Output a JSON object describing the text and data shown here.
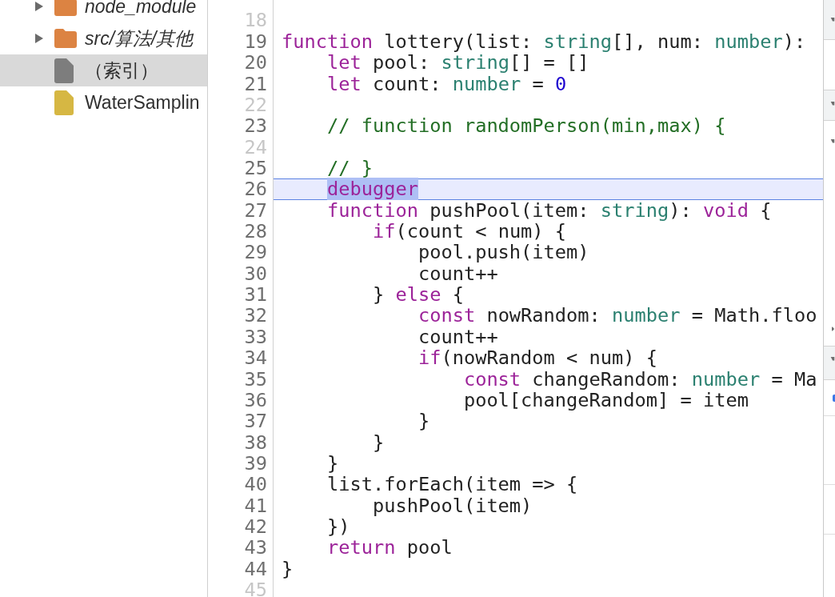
{
  "file_tree": {
    "items": [
      {
        "kind": "folder",
        "name": "node_module",
        "expanded": false,
        "selected": false,
        "color": "#dc8342"
      },
      {
        "kind": "folder",
        "name": "src/算法/其他",
        "expanded": false,
        "selected": false,
        "color": "#dc8342"
      },
      {
        "kind": "file",
        "name": "（索引）",
        "selected": true,
        "color": "#7d7d7d"
      },
      {
        "kind": "file",
        "name": "WaterSamplin",
        "selected": false,
        "color": "#d6b743"
      }
    ]
  },
  "code": {
    "lines": [
      {
        "number": "18",
        "dimmed": true,
        "current": false
      },
      {
        "number": "19",
        "dimmed": false,
        "current": false,
        "tokens": [
          {
            "kind": "keyword",
            "text": "function"
          },
          {
            "kind": "plain",
            "text": " lottery(list: "
          },
          {
            "kind": "type",
            "text": "string"
          },
          {
            "kind": "plain",
            "text": "[], num: "
          },
          {
            "kind": "type",
            "text": "number"
          },
          {
            "kind": "plain",
            "text": "):"
          }
        ]
      },
      {
        "number": "20",
        "dimmed": false,
        "current": false,
        "tokens": [
          {
            "kind": "keyword",
            "text": "    let"
          },
          {
            "kind": "plain",
            "text": " pool: "
          },
          {
            "kind": "type",
            "text": "string"
          },
          {
            "kind": "plain",
            "text": "[] = []"
          }
        ]
      },
      {
        "number": "21",
        "dimmed": false,
        "current": false,
        "tokens": [
          {
            "kind": "keyword",
            "text": "    let"
          },
          {
            "kind": "plain",
            "text": " count: "
          },
          {
            "kind": "type",
            "text": "number"
          },
          {
            "kind": "plain",
            "text": " = "
          },
          {
            "kind": "number",
            "text": "0"
          }
        ]
      },
      {
        "number": "22",
        "dimmed": true,
        "current": false
      },
      {
        "number": "23",
        "dimmed": false,
        "current": false,
        "tokens": [
          {
            "kind": "comment",
            "text": "    // function randomPerson(min,max) {"
          }
        ]
      },
      {
        "number": "24",
        "dimmed": true,
        "current": false
      },
      {
        "number": "25",
        "dimmed": false,
        "current": false,
        "tokens": [
          {
            "kind": "comment",
            "text": "    // }"
          }
        ]
      },
      {
        "number": "26",
        "dimmed": false,
        "current": true,
        "tokens": [
          {
            "kind": "keyword",
            "text": "    debugger",
            "highlighted": true
          }
        ]
      },
      {
        "number": "27",
        "dimmed": false,
        "current": false,
        "tokens": [
          {
            "kind": "keyword",
            "text": "    function"
          },
          {
            "kind": "plain",
            "text": " pushPool(item: "
          },
          {
            "kind": "type",
            "text": "string"
          },
          {
            "kind": "plain",
            "text": "): "
          },
          {
            "kind": "keyword",
            "text": "void"
          },
          {
            "kind": "plain",
            "text": " {"
          }
        ]
      },
      {
        "number": "28",
        "dimmed": false,
        "current": false,
        "tokens": [
          {
            "kind": "keyword",
            "text": "        if"
          },
          {
            "kind": "plain",
            "text": "(count < num) {"
          }
        ]
      },
      {
        "number": "29",
        "dimmed": false,
        "current": false,
        "tokens": [
          {
            "kind": "plain",
            "text": "            pool.push(item)"
          }
        ]
      },
      {
        "number": "30",
        "dimmed": false,
        "current": false,
        "tokens": [
          {
            "kind": "plain",
            "text": "            count++"
          }
        ]
      },
      {
        "number": "31",
        "dimmed": false,
        "current": false,
        "tokens": [
          {
            "kind": "plain",
            "text": "        } "
          },
          {
            "kind": "keyword",
            "text": "else"
          },
          {
            "kind": "plain",
            "text": " {"
          }
        ]
      },
      {
        "number": "32",
        "dimmed": false,
        "current": false,
        "tokens": [
          {
            "kind": "keyword",
            "text": "            const"
          },
          {
            "kind": "plain",
            "text": " nowRandom: "
          },
          {
            "kind": "type",
            "text": "number"
          },
          {
            "kind": "plain",
            "text": " = Math.floo"
          }
        ]
      },
      {
        "number": "33",
        "dimmed": false,
        "current": false,
        "tokens": [
          {
            "kind": "plain",
            "text": "            count++"
          }
        ]
      },
      {
        "number": "34",
        "dimmed": false,
        "current": false,
        "tokens": [
          {
            "kind": "keyword",
            "text": "            if"
          },
          {
            "kind": "plain",
            "text": "(nowRandom < num) {"
          }
        ]
      },
      {
        "number": "35",
        "dimmed": false,
        "current": false,
        "tokens": [
          {
            "kind": "keyword",
            "text": "                const"
          },
          {
            "kind": "plain",
            "text": " changeRandom: "
          },
          {
            "kind": "type",
            "text": "number"
          },
          {
            "kind": "plain",
            "text": " = Ma"
          }
        ]
      },
      {
        "number": "36",
        "dimmed": false,
        "current": false,
        "tokens": [
          {
            "kind": "plain",
            "text": "                pool[changeRandom] = item"
          }
        ]
      },
      {
        "number": "37",
        "dimmed": false,
        "current": false,
        "tokens": [
          {
            "kind": "plain",
            "text": "            }"
          }
        ]
      },
      {
        "number": "38",
        "dimmed": false,
        "current": false,
        "tokens": [
          {
            "kind": "plain",
            "text": "        }"
          }
        ]
      },
      {
        "number": "39",
        "dimmed": false,
        "current": false,
        "tokens": [
          {
            "kind": "plain",
            "text": "    }"
          }
        ]
      },
      {
        "number": "40",
        "dimmed": false,
        "current": false,
        "tokens": [
          {
            "kind": "plain",
            "text": "    list.forEach(item => {"
          }
        ]
      },
      {
        "number": "41",
        "dimmed": false,
        "current": false,
        "tokens": [
          {
            "kind": "plain",
            "text": "        pushPool(item)"
          }
        ]
      },
      {
        "number": "42",
        "dimmed": false,
        "current": false,
        "tokens": [
          {
            "kind": "plain",
            "text": "    })"
          }
        ]
      },
      {
        "number": "43",
        "dimmed": false,
        "current": false,
        "tokens": [
          {
            "kind": "keyword",
            "text": "    return"
          },
          {
            "kind": "plain",
            "text": " pool"
          }
        ]
      },
      {
        "number": "44",
        "dimmed": false,
        "current": false,
        "tokens": [
          {
            "kind": "plain",
            "text": "}"
          }
        ]
      },
      {
        "number": "45",
        "dimmed": true,
        "current": false
      }
    ]
  },
  "debugger_pane": {
    "sections": [
      {
        "expanded": true
      },
      {
        "expanded": true,
        "tree": [
          {
            "expanded": true
          },
          {
            "expanded": false
          }
        ]
      },
      {
        "expanded": true,
        "breakpoint_checked": true
      }
    ]
  }
}
